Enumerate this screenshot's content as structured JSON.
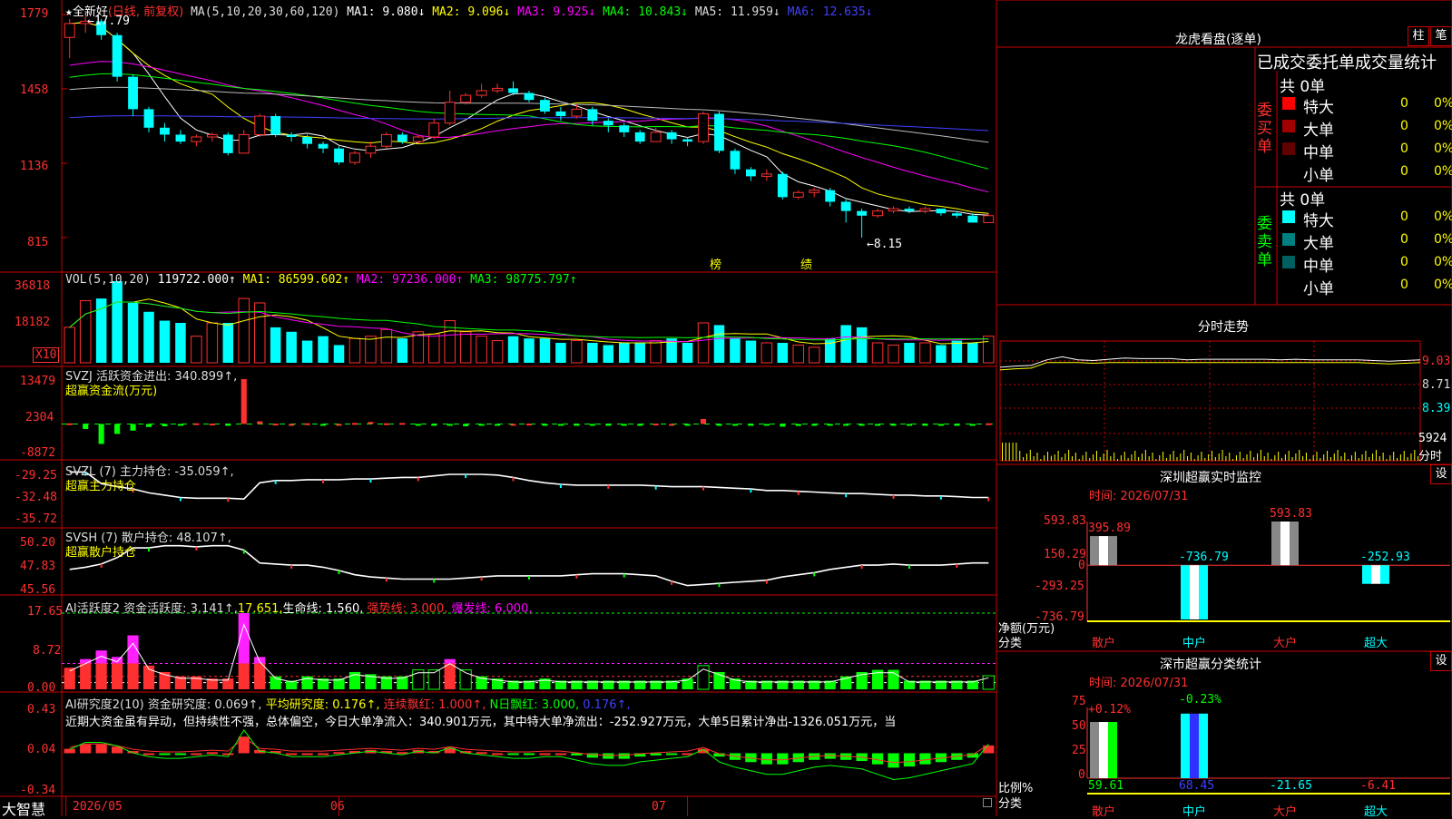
{
  "colors": {
    "up": "#ff3030",
    "down": "#00ffff",
    "bg": "#000000",
    "grid": "#cc0000",
    "ma1": "#ffffff",
    "ma2": "#ffff00",
    "ma3": "#ff00ff",
    "ma4": "#00ff00",
    "ma5": "#bbbbbb",
    "ma6": "#4040ff",
    "green": "#00ff00",
    "pink": "#ff20ff"
  },
  "header": {
    "star": "★",
    "stock_name": "全新好",
    "period": "(日线, 前复权)",
    "ma_def": "MA(5,10,20,30,60,120)",
    "ma1": "MA1: 9.080↓",
    "ma2": "MA2: 9.096↓",
    "ma3": "MA3: 9.925↓",
    "ma4": "MA4: 10.843↓",
    "ma5": "MA5: 11.959↓",
    "ma6": "MA6: 12.635↓"
  },
  "markers": {
    "bang": "榜",
    "ji": "绩",
    "high_label": "←17.79",
    "low_label": "←8.15"
  },
  "price_axis": [
    "1779",
    "1458",
    "1136",
    "815"
  ],
  "vol_panel": {
    "title": "VOL(5,10,20)",
    "value": "119722.000↑",
    "ma1": "MA1: 86599.602↑",
    "ma2": "MA2: 97236.000↑",
    "ma3": "MA3: 98775.797↑",
    "axis": [
      "36818",
      "18182"
    ],
    "unit": "X10"
  },
  "svzj_panel": {
    "title": "SVZJ  活跃资金进出: 340.899↑,",
    "sub": "超赢资金流(万元)",
    "axis": [
      "13479",
      "2304",
      "-8872"
    ]
  },
  "svzl_panel": {
    "title": "SVZL (7) 主力持仓: -35.059↑,",
    "sub": "超赢主力持仓",
    "axis": [
      "-29.25",
      "-32.48",
      "-35.72"
    ]
  },
  "svsh_panel": {
    "title": "SVSH (7) 散户持仓: 48.107↑,",
    "sub": "超赢散户持仓",
    "axis": [
      "50.20",
      "47.83",
      "45.56"
    ]
  },
  "ai_active_panel": {
    "title": "AI活跃度2 资金活跃度: 3.141↑,",
    "v1": "17.651,",
    "v2": "生命线: 1.560,",
    "v3": "强势线: 3.000,",
    "v4": "爆发线: 6.000,",
    "axis": [
      "17.65",
      "8.72",
      "0.00"
    ]
  },
  "ai_research_panel": {
    "title": "AI研究度2(10) 资金研究度: 0.069↑,",
    "avg": "平均研究度: 0.176↑,",
    "streak": "连续飘红: 1.000↑,",
    "nday": "N日飘红: 3.000,",
    "tail": "0.176↑,",
    "comment": "近期大资金虽有异动，但持续性不强，总体偏空，今日大单净流入：340.901万元，其中特大单净流出：-252.927万元，大单5日累计净出-1326.051万元，当",
    "axis": [
      "0.43",
      "0.04",
      "-0.34"
    ]
  },
  "bottom_bar": {
    "brand": "大智慧",
    "dates": [
      "2026/05",
      "06",
      "07"
    ]
  },
  "dragon_tiger": {
    "title": "龙虎看盘(逐单)",
    "tab_bar": "柱",
    "tab_pen": "笔",
    "stat_title": "已成交委托单成交量统计",
    "buy_group": "委买单",
    "sell_group": "委卖单",
    "buy_total": "共 0单",
    "sell_total": "共 0单",
    "buy_rows": [
      {
        "name": "特大",
        "count": "0",
        "pct": "0%",
        "color": "#ff0000"
      },
      {
        "name": "大单",
        "count": "0",
        "pct": "0%",
        "color": "#a00000"
      },
      {
        "name": "中单",
        "count": "0",
        "pct": "0%",
        "color": "#600000"
      },
      {
        "name": "小单",
        "count": "0",
        "pct": "0%",
        "color": ""
      }
    ],
    "sell_rows": [
      {
        "name": "特大",
        "count": "0",
        "pct": "0%",
        "color": "#00ffff"
      },
      {
        "name": "大单",
        "count": "0",
        "pct": "0%",
        "color": "#008080"
      },
      {
        "name": "中单",
        "count": "0",
        "pct": "0%",
        "color": "#006060"
      },
      {
        "name": "小单",
        "count": "0",
        "pct": "0%",
        "color": ""
      }
    ]
  },
  "intraday": {
    "title": "分时走势",
    "axis": [
      "9.03",
      "8.71",
      "8.39"
    ],
    "vol_max": "5924",
    "vol_label": "分时"
  },
  "sz_monitor": {
    "title": "深圳超赢实时监控",
    "settings": "设",
    "time": "时间: 2026/07/31",
    "axis": [
      "593.83",
      "150.29",
      "0",
      "-293.25",
      "-736.79"
    ],
    "ylabel1": "净额(万元)",
    "ylabel2": "分类",
    "cats": [
      "散户",
      "中户",
      "大户",
      "超大"
    ],
    "values": [
      "395.89",
      "-736.79",
      "593.83",
      "-252.93"
    ]
  },
  "sz_class": {
    "title": "深市超赢分类统计",
    "settings": "设",
    "time": "时间: 2026/07/31",
    "axis": [
      "75",
      "50",
      "25",
      "0"
    ],
    "ylabel1": "比例%",
    "ylabel2": "分类",
    "top_labels": [
      "+0.12%",
      "-0.23%"
    ],
    "values": [
      "59.61",
      "68.45",
      "-21.65",
      "-6.41"
    ],
    "cats": [
      "散户",
      "中户",
      "大户",
      "超大"
    ]
  },
  "chart_data": [
    {
      "type": "candlestick",
      "title": "全新好 (日线, 前复权)",
      "x": [
        "2026/05",
        "06",
        "07"
      ],
      "ylim": [
        8.15,
        17.79
      ],
      "ohlc": [
        [
          16.8,
          17.4,
          17.6,
          15.9
        ],
        [
          17.4,
          17.5,
          17.79,
          17.0
        ],
        [
          17.5,
          16.9,
          17.6,
          16.7
        ],
        [
          16.9,
          15.1,
          17.0,
          14.9
        ],
        [
          15.1,
          13.7,
          15.2,
          13.4
        ],
        [
          13.7,
          12.9,
          13.8,
          12.7
        ],
        [
          12.9,
          12.6,
          13.1,
          12.3
        ],
        [
          12.6,
          12.3,
          12.8,
          12.2
        ],
        [
          12.3,
          12.5,
          12.6,
          12.1
        ],
        [
          12.5,
          12.6,
          12.7,
          12.3
        ],
        [
          12.6,
          11.8,
          12.7,
          11.7
        ],
        [
          11.8,
          12.6,
          12.8,
          11.8
        ],
        [
          12.6,
          13.4,
          13.5,
          12.5
        ],
        [
          13.4,
          12.6,
          13.5,
          12.5
        ],
        [
          12.6,
          12.5,
          12.7,
          12.3
        ],
        [
          12.5,
          12.2,
          12.6,
          12.0
        ],
        [
          12.2,
          12.0,
          12.3,
          11.8
        ],
        [
          12.0,
          11.4,
          12.1,
          11.3
        ],
        [
          11.4,
          11.8,
          11.9,
          11.3
        ],
        [
          11.8,
          12.1,
          12.3,
          11.6
        ],
        [
          12.1,
          12.6,
          12.7,
          12.0
        ],
        [
          12.6,
          12.3,
          12.7,
          12.2
        ],
        [
          12.3,
          12.5,
          12.6,
          12.2
        ],
        [
          12.5,
          13.1,
          13.3,
          12.4
        ],
        [
          13.1,
          14.0,
          14.5,
          13.0
        ],
        [
          14.0,
          14.3,
          14.4,
          13.9
        ],
        [
          14.3,
          14.5,
          14.8,
          14.2
        ],
        [
          14.5,
          14.6,
          14.8,
          14.4
        ],
        [
          14.6,
          14.4,
          14.9,
          14.3
        ],
        [
          14.4,
          14.1,
          14.5,
          14.0
        ],
        [
          14.1,
          13.6,
          14.2,
          13.5
        ],
        [
          13.6,
          13.4,
          13.8,
          13.2
        ],
        [
          13.4,
          13.7,
          13.9,
          13.3
        ],
        [
          13.7,
          13.2,
          13.8,
          13.0
        ],
        [
          13.2,
          13.0,
          13.3,
          12.7
        ],
        [
          13.0,
          12.7,
          13.1,
          12.5
        ],
        [
          12.7,
          12.3,
          12.8,
          12.2
        ],
        [
          12.3,
          12.7,
          12.9,
          12.3
        ],
        [
          12.7,
          12.4,
          12.8,
          12.2
        ],
        [
          12.4,
          12.3,
          12.5,
          12.1
        ],
        [
          12.3,
          13.5,
          13.6,
          12.2
        ],
        [
          13.5,
          11.9,
          13.6,
          11.8
        ],
        [
          11.9,
          11.1,
          12.0,
          10.9
        ],
        [
          11.1,
          10.8,
          11.2,
          10.6
        ],
        [
          10.8,
          10.9,
          11.1,
          10.6
        ],
        [
          10.9,
          9.9,
          11.0,
          9.8
        ],
        [
          9.9,
          10.1,
          10.2,
          9.8
        ],
        [
          10.1,
          10.2,
          10.3,
          9.9
        ],
        [
          10.2,
          9.7,
          10.3,
          9.5
        ],
        [
          9.7,
          9.3,
          9.8,
          8.8
        ],
        [
          9.3,
          9.1,
          9.4,
          8.15
        ],
        [
          9.1,
          9.3,
          9.4,
          9.0
        ],
        [
          9.3,
          9.4,
          9.5,
          9.2
        ],
        [
          9.4,
          9.3,
          9.5,
          9.2
        ],
        [
          9.3,
          9.4,
          9.5,
          9.2
        ],
        [
          9.4,
          9.2,
          9.4,
          9.1
        ],
        [
          9.2,
          9.1,
          9.3,
          9.0
        ],
        [
          9.1,
          8.8,
          9.2,
          8.8
        ],
        [
          8.8,
          9.1,
          9.2,
          8.8
        ]
      ],
      "series_ma": [
        "MA1",
        "MA2",
        "MA3",
        "MA4",
        "MA5",
        "MA6"
      ]
    },
    {
      "type": "bar",
      "title": "VOL(5,10,20)",
      "ylim": [
        0,
        36818
      ],
      "values": [
        16000,
        28000,
        29000,
        36818,
        27000,
        23000,
        19000,
        18000,
        12000,
        18000,
        18000,
        29000,
        27000,
        16000,
        14000,
        10000,
        12000,
        8000,
        11000,
        12000,
        15000,
        11000,
        14000,
        13000,
        19000,
        14000,
        12000,
        10000,
        12000,
        11000,
        11000,
        9000,
        10000,
        9000,
        8000,
        9000,
        9000,
        10000,
        11000,
        9000,
        18000,
        17000,
        11000,
        10000,
        9000,
        9000,
        8000,
        7000,
        11000,
        17000,
        16000,
        9000,
        8000,
        9000,
        9000,
        8000,
        10000,
        9000,
        12000
      ],
      "up": [
        true,
        true,
        false,
        false,
        false,
        false,
        false,
        false,
        true,
        true,
        false,
        true,
        true,
        false,
        false,
        false,
        false,
        false,
        true,
        true,
        true,
        false,
        true,
        true,
        true,
        true,
        true,
        true,
        false,
        false,
        false,
        false,
        true,
        false,
        false,
        false,
        false,
        true,
        false,
        false,
        true,
        false,
        false,
        false,
        true,
        false,
        true,
        true,
        false,
        false,
        false,
        true,
        true,
        false,
        true,
        false,
        false,
        false,
        true
      ]
    },
    {
      "type": "bar",
      "title": "超赢资金流(万元)",
      "ylim": [
        -8872,
        13479
      ],
      "values": [
        200,
        -1500,
        -6000,
        -3000,
        -2000,
        -900,
        -700,
        -500,
        200,
        100,
        -400,
        13479,
        800,
        100,
        0,
        200,
        -200,
        0,
        300,
        600,
        200,
        300,
        -300,
        -200,
        -500,
        -700,
        -400,
        -200,
        0,
        100,
        -200,
        -500,
        -300,
        -400,
        -100,
        -200,
        -100,
        100,
        0,
        -300,
        1500,
        -200,
        -300,
        -100,
        -400,
        -800,
        -600,
        -300,
        -200,
        -100,
        -400,
        -200,
        -300,
        -100,
        -200,
        -100,
        -300,
        -100,
        200
      ]
    },
    {
      "type": "line",
      "title": "超赢主力持仓",
      "ylim": [
        -35.72,
        -29.25
      ],
      "values": [
        -29.3,
        -29.3,
        -30.8,
        -31.2,
        -31.5,
        -32.0,
        -32.3,
        -32.6,
        -32.7,
        -32.7,
        -32.7,
        -32.8,
        -30.7,
        -30.4,
        -30.4,
        -30.3,
        -30.3,
        -30.3,
        -30.2,
        -30.2,
        -30.1,
        -30.0,
        -30.0,
        -29.8,
        -29.6,
        -29.6,
        -29.6,
        -29.7,
        -30.0,
        -30.4,
        -30.7,
        -30.9,
        -31.0,
        -31.0,
        -31.0,
        -31.0,
        -31.0,
        -31.1,
        -31.2,
        -31.2,
        -31.2,
        -31.3,
        -31.4,
        -31.5,
        -31.7,
        -31.7,
        -31.8,
        -31.9,
        -32.0,
        -32.1,
        -32.1,
        -32.2,
        -32.3,
        -32.3,
        -32.4,
        -32.4,
        -32.5,
        -32.6,
        -32.6
      ]
    },
    {
      "type": "line",
      "title": "超赢散户持仓",
      "ylim": [
        45.56,
        50.2
      ],
      "values": [
        47.6,
        47.8,
        48.1,
        48.7,
        49.6,
        49.6,
        49.8,
        49.8,
        49.7,
        49.8,
        49.8,
        49.4,
        48.2,
        48.1,
        48.0,
        48.0,
        47.8,
        47.5,
        47.1,
        46.9,
        46.8,
        46.7,
        46.7,
        46.7,
        46.7,
        46.8,
        46.9,
        47.0,
        47.0,
        47.0,
        47.0,
        47.0,
        47.1,
        47.2,
        47.2,
        47.2,
        47.1,
        47.0,
        46.5,
        46.1,
        46.2,
        46.3,
        46.4,
        46.5,
        46.6,
        46.9,
        47.1,
        47.3,
        47.6,
        47.8,
        48.0,
        48.0,
        48.1,
        48.0,
        48.0,
        48.0,
        48.1,
        48.2,
        48.2
      ]
    },
    {
      "type": "bar",
      "title": "AI活跃度2",
      "ylim": [
        0,
        17.65
      ],
      "values": [
        5.0,
        7.0,
        9.0,
        7.5,
        12.5,
        5.5,
        4.0,
        3.0,
        3.0,
        2.5,
        2.5,
        17.65,
        7.5,
        3.0,
        2.0,
        3.0,
        2.5,
        2.5,
        4.0,
        3.5,
        3.0,
        3.0,
        4.5,
        4.5,
        7.0,
        4.5,
        3.0,
        2.5,
        2.0,
        2.0,
        2.5,
        2.0,
        2.0,
        2.0,
        2.0,
        2.0,
        2.0,
        2.0,
        2.0,
        2.5,
        5.5,
        4.0,
        2.5,
        2.0,
        2.0,
        2.0,
        2.0,
        2.0,
        2.0,
        3.0,
        4.0,
        4.5,
        4.5,
        2.0,
        2.0,
        2.0,
        2.0,
        2.0,
        3.14
      ]
    },
    {
      "type": "bar",
      "title": "AI研究度2(10)",
      "ylim": [
        -0.34,
        0.43
      ],
      "values": [
        0.04,
        0.08,
        0.08,
        0.06,
        0.02,
        0.0,
        -0.01,
        -0.01,
        0.0,
        0.01,
        0.0,
        0.15,
        0.03,
        0.02,
        0.0,
        0.0,
        0.0,
        0.01,
        0.02,
        0.03,
        0.02,
        0.01,
        0.03,
        0.02,
        0.05,
        0.02,
        0.01,
        0.0,
        -0.01,
        -0.01,
        0.0,
        0.0,
        -0.02,
        -0.04,
        -0.05,
        -0.05,
        -0.03,
        -0.02,
        -0.01,
        0.0,
        0.04,
        -0.03,
        -0.06,
        -0.08,
        -0.1,
        -0.1,
        -0.08,
        -0.06,
        -0.05,
        -0.06,
        -0.07,
        -0.1,
        -0.13,
        -0.12,
        -0.1,
        -0.08,
        -0.06,
        -0.04,
        0.07
      ]
    },
    {
      "type": "line",
      "title": "分时走势",
      "ylim": [
        8.39,
        9.03
      ],
      "values": [
        8.98,
        9.0,
        9.01,
        9.1,
        9.15,
        9.1,
        9.09,
        9.11,
        9.13,
        9.12,
        9.12,
        9.12,
        9.1,
        9.11,
        9.11,
        9.11,
        9.11,
        9.11,
        9.1,
        9.11,
        9.1,
        9.1,
        9.1,
        9.1,
        9.09,
        9.08,
        9.09,
        9.1
      ]
    },
    {
      "type": "bar",
      "title": "深圳超赢实时监控",
      "categories": [
        "散户",
        "中户",
        "大户",
        "超大"
      ],
      "values": [
        395.89,
        -736.79,
        593.83,
        -252.93
      ],
      "ylim": [
        -736.79,
        593.83
      ],
      "ylabel": "净额(万元)"
    },
    {
      "type": "bar",
      "title": "深市超赢分类统计",
      "categories": [
        "散户",
        "中户",
        "大户",
        "超大"
      ],
      "values": [
        59.61,
        68.45,
        -21.65,
        -6.41
      ],
      "ylim": [
        0,
        75
      ],
      "ylabel": "比例%"
    }
  ]
}
